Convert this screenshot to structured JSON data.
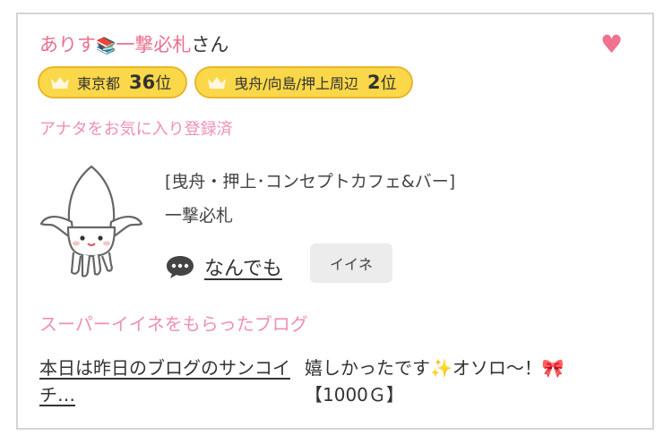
{
  "profile": {
    "name_part1": "ありす",
    "name_emoji": "📚",
    "name_part2": "一撃必札",
    "honorific": "さん",
    "heart_icon": "heart-icon",
    "accent_color": "#e8708f"
  },
  "badges": [
    {
      "area": "東京都",
      "rank": "36",
      "suffix": "位"
    },
    {
      "area": "曳舟/向島/押上周辺",
      "rank": "2",
      "suffix": "位"
    }
  ],
  "favorite_status": "アナタをお気に入り登録済",
  "shop": {
    "category": "[曳舟・押上･コンセプトカフェ&バー]",
    "name": "一撃必札"
  },
  "comment": {
    "icon": "speech-bubble-icon",
    "text": "なんでも"
  },
  "iine_button": "イイネ",
  "super_iine_title": "スーパーイイネをもらったブログ",
  "blog": {
    "title": "本日は昨日のブログのサンコイチ…",
    "comment": "嬉しかったです✨オソロ〜！🎀【1000Ｇ】"
  }
}
